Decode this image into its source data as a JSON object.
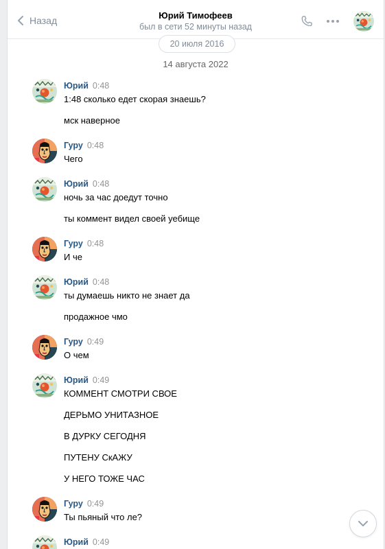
{
  "header": {
    "back_label": "Назад",
    "title": "Юрий Тимофеев",
    "subtitle": "был в сети 52 минуты назад"
  },
  "date_pill": "20 июля 2016",
  "date_separator": "14 августа 2022",
  "messages": [
    {
      "author": "Юрий",
      "time": "0:48",
      "avatar": "yuri",
      "lines": [
        "1:48 сколько едет скорая знаешь?",
        "мск наверное"
      ]
    },
    {
      "author": "Гуру",
      "time": "0:48",
      "avatar": "guru",
      "lines": [
        "Чего"
      ]
    },
    {
      "author": "Юрий",
      "time": "0:48",
      "avatar": "yuri",
      "lines": [
        "ночь за час доедут точно",
        "ты коммент видел своей уебище"
      ]
    },
    {
      "author": "Гуру",
      "time": "0:48",
      "avatar": "guru",
      "lines": [
        "И че"
      ]
    },
    {
      "author": "Юрий",
      "time": "0:48",
      "avatar": "yuri",
      "lines": [
        "ты думаешь никто не знает да",
        "продажное чмо"
      ]
    },
    {
      "author": "Гуру",
      "time": "0:49",
      "avatar": "guru",
      "lines": [
        "О чем"
      ]
    },
    {
      "author": "Юрий",
      "time": "0:49",
      "avatar": "yuri",
      "lines": [
        "КОММЕНТ СМОТРИ СВОЕ",
        "ДЕРЬМО УНИТАЗНОЕ",
        "В ДУРКУ СЕГОДНЯ",
        "ПУТЕНУ СкАЖУ",
        "У НЕГО ТОЖЕ ЧАС"
      ]
    },
    {
      "author": "Гуру",
      "time": "0:49",
      "avatar": "guru",
      "lines": [
        "Ты пьяный что ле?"
      ]
    },
    {
      "author": "Юрий",
      "time": "0:49",
      "avatar": "yuri",
      "lines": []
    }
  ],
  "colors": {
    "author_link": "#2a5885",
    "secondary_text": "#818c99",
    "time_text": "#939393"
  },
  "icons": {
    "back": "chevron-left-icon",
    "call": "phone-icon",
    "more": "more-horizontal-icon",
    "scroll": "chevron-down-icon"
  }
}
